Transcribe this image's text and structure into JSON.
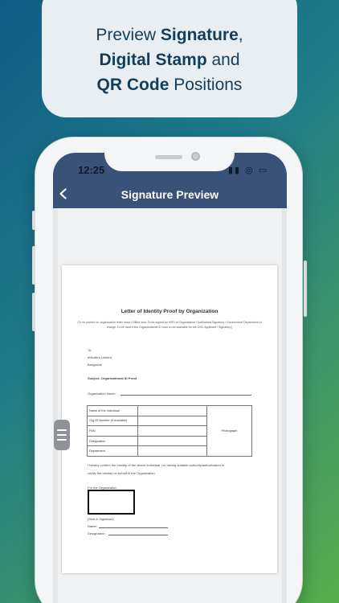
{
  "headline": {
    "line1_pre": "Preview ",
    "line1_bold": "Signature",
    "line1_post": ",",
    "line2_bold": "Digital Stamp",
    "line2_post": " and",
    "line3_bold": "QR Code",
    "line3_post": " Positions"
  },
  "status_bar": {
    "time": "12:25",
    "icons": "▮▮ ◎ ▭"
  },
  "app_bar": {
    "title": "Signature Preview",
    "back_icon": "chevron-left-icon"
  },
  "document": {
    "title": "Letter of Identity Proof by Organization",
    "note": "(To be printed on organization letter head / Office seal. To be signed by HRD of Organization / Authorised Signatory / Government Department in charge. To be used if the Organizational ID card is not available for the DSC Applicant / Signatory.)",
    "to_label": "To:",
    "to_name": "eMudhra Limited",
    "to_city": "Bangalore",
    "subject": "Subject: Organizational ID Proof",
    "org_name_label": "Organization Name:",
    "table_rows": [
      "Name of the Individual",
      "Org ID Number (if available)",
      "PAN",
      "Designation",
      "Department"
    ],
    "photo_label": "Photograph",
    "confirm_1": "I hereby confirm the identity of the above individual. I'm having suitable authority/authorization to",
    "confirm_2": "certify the identity on behalf of the Organization.",
    "for_org": "For the Organization",
    "seal_label": "(Seal & Signature)",
    "name_label": "Name:",
    "designation_label": "Designation:"
  },
  "colors": {
    "app_bar": "#3a5278",
    "headline_text": "#123e5c"
  }
}
